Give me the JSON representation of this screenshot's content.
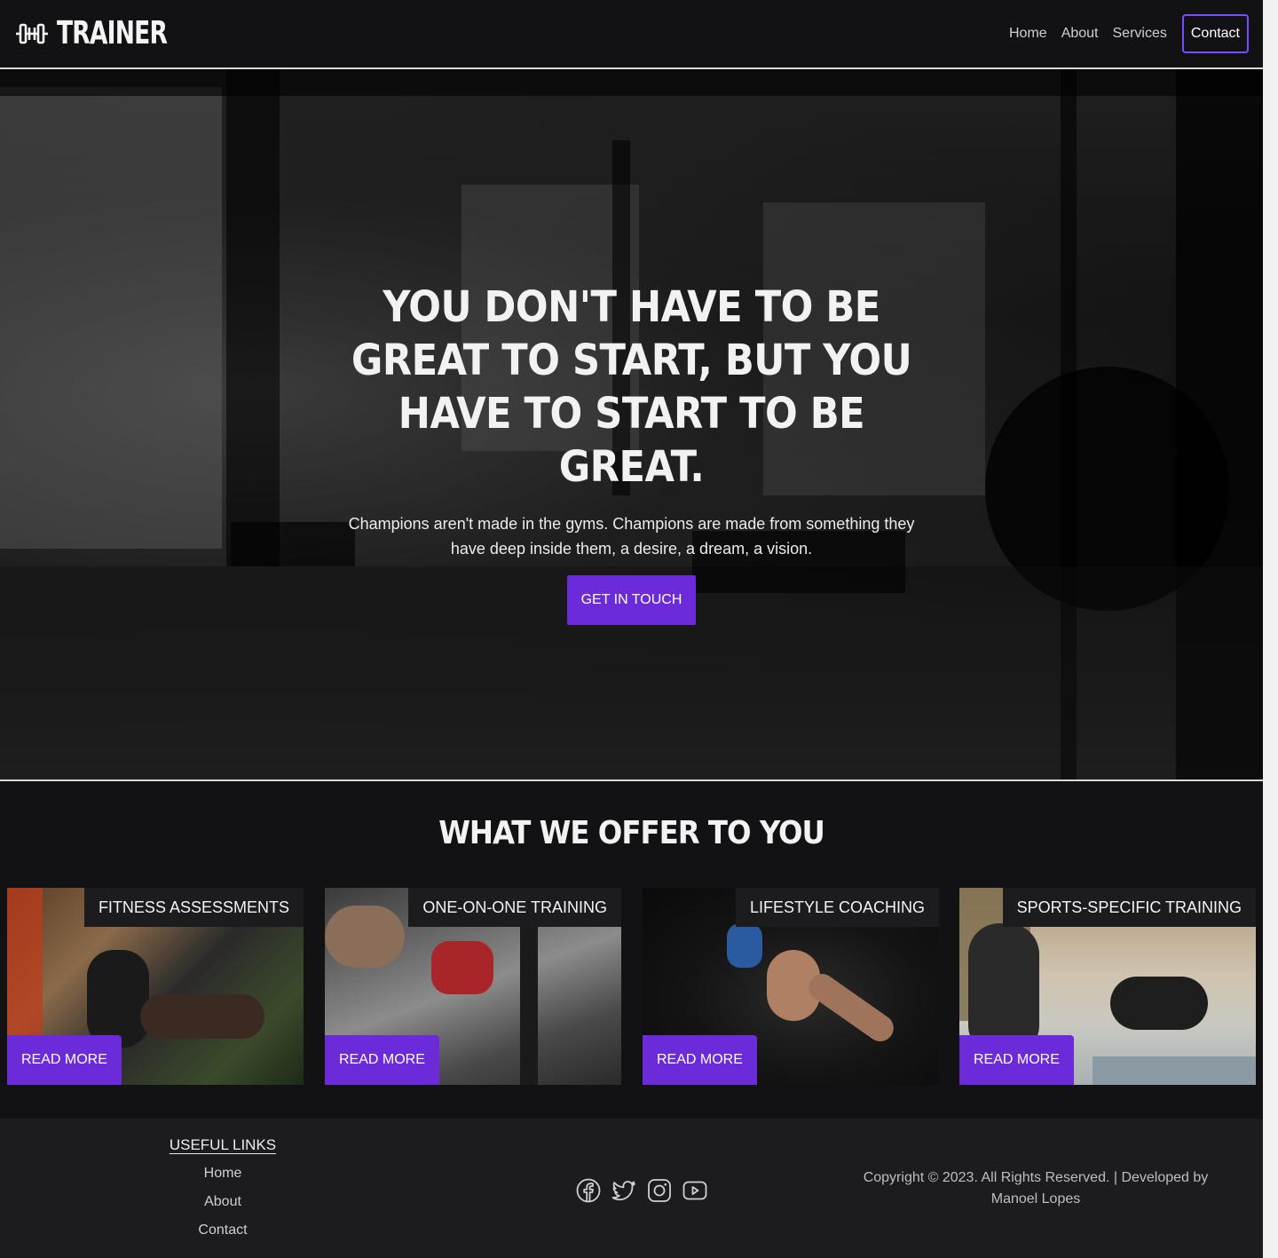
{
  "nav": {
    "brand": "TRAINER",
    "brand_icon": "dumbbell-icon",
    "links": [
      "Home",
      "About",
      "Services"
    ],
    "contact_label": "Contact"
  },
  "hero": {
    "title": "You don't have to be great to start, but you have to start to be great.",
    "subtitle": "Champions aren't made in the gyms. Champions are made from something they have deep inside them, a desire, a dream, a vision.",
    "cta_label": "GET IN TOUCH"
  },
  "offers": {
    "title": "WHAT WE OFFER TO YOU",
    "cards": [
      {
        "title": "FITNESS ASSESSMENTS",
        "button": "READ MORE"
      },
      {
        "title": "ONE-ON-ONE TRAINING",
        "button": "READ MORE"
      },
      {
        "title": "LIFESTYLE COACHING",
        "button": "READ MORE"
      },
      {
        "title": "SPORTS-SPECIFIC TRAINING",
        "button": "READ MORE"
      }
    ]
  },
  "footer": {
    "useful_title": "USEFUL LINKS",
    "useful_links": [
      "Home",
      "About",
      "Contact"
    ],
    "socials": [
      "facebook-icon",
      "twitter-icon",
      "instagram-icon",
      "youtube-icon"
    ],
    "copyright": "Copyright © 2023. All Rights Reserved. | Developed by Manoel Lopes"
  },
  "colors": {
    "accent": "#6c2bd9",
    "background": "#121214",
    "footer": "#1c1c1e"
  }
}
